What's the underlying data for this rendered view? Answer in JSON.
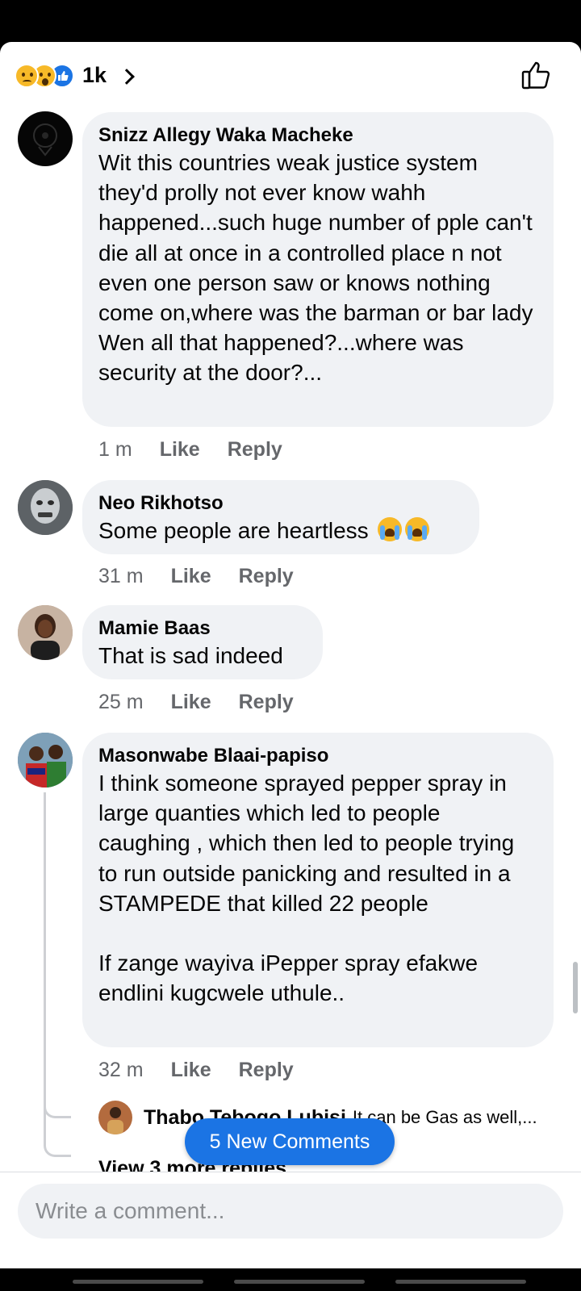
{
  "header": {
    "reaction_icons": [
      "sad-reaction-icon",
      "wow-reaction-icon",
      "like-reaction-icon"
    ],
    "reaction_count": "1k",
    "chevron_icon": "chevron-right-icon",
    "like_icon": "thumbs-up-outline-icon"
  },
  "comments": [
    {
      "author": "Snizz Allegy Waka Macheke",
      "text": "Wit this countries weak justice system they'd prolly not ever know wahh happened...such huge number of pple can't die all at once in a controlled place n not even one person saw or knows nothing come on,where was the barman or bar lady Wen all that happened?...where was security at the door?...",
      "time": "1 m",
      "like": "Like",
      "reply": "Reply"
    },
    {
      "author": "Neo Rikhotso",
      "text": "Some people are heartless",
      "emojis": [
        "loudly-crying-face-icon",
        "loudly-crying-face-icon"
      ],
      "time": "31 m",
      "like": "Like",
      "reply": "Reply"
    },
    {
      "author": "Mamie Baas",
      "text": "That is sad indeed",
      "time": "25 m",
      "like": "Like",
      "reply": "Reply"
    },
    {
      "author": "Masonwabe Blaai-papiso",
      "text": "I think someone sprayed pepper spray in large quanties which led to people caughing , which then led to people trying to run outside panicking and resulted in a STAMPEDE that killed 22 people\n\nIf zange wayiva iPepper spray efakwe endlini kugcwele uthule..",
      "time": "32 m",
      "like": "Like",
      "reply": "Reply"
    }
  ],
  "reply_preview": {
    "author": "Thabo Tebogo Lubisi",
    "text": "It can be Gas as well,..."
  },
  "view_more": "View 3 more replies",
  "new_comments_button": "5 New Comments",
  "composer": {
    "placeholder": "Write a comment..."
  },
  "colors": {
    "accent": "#1b74e4",
    "bubble": "#f0f2f5",
    "secondary_text": "#65676b"
  }
}
